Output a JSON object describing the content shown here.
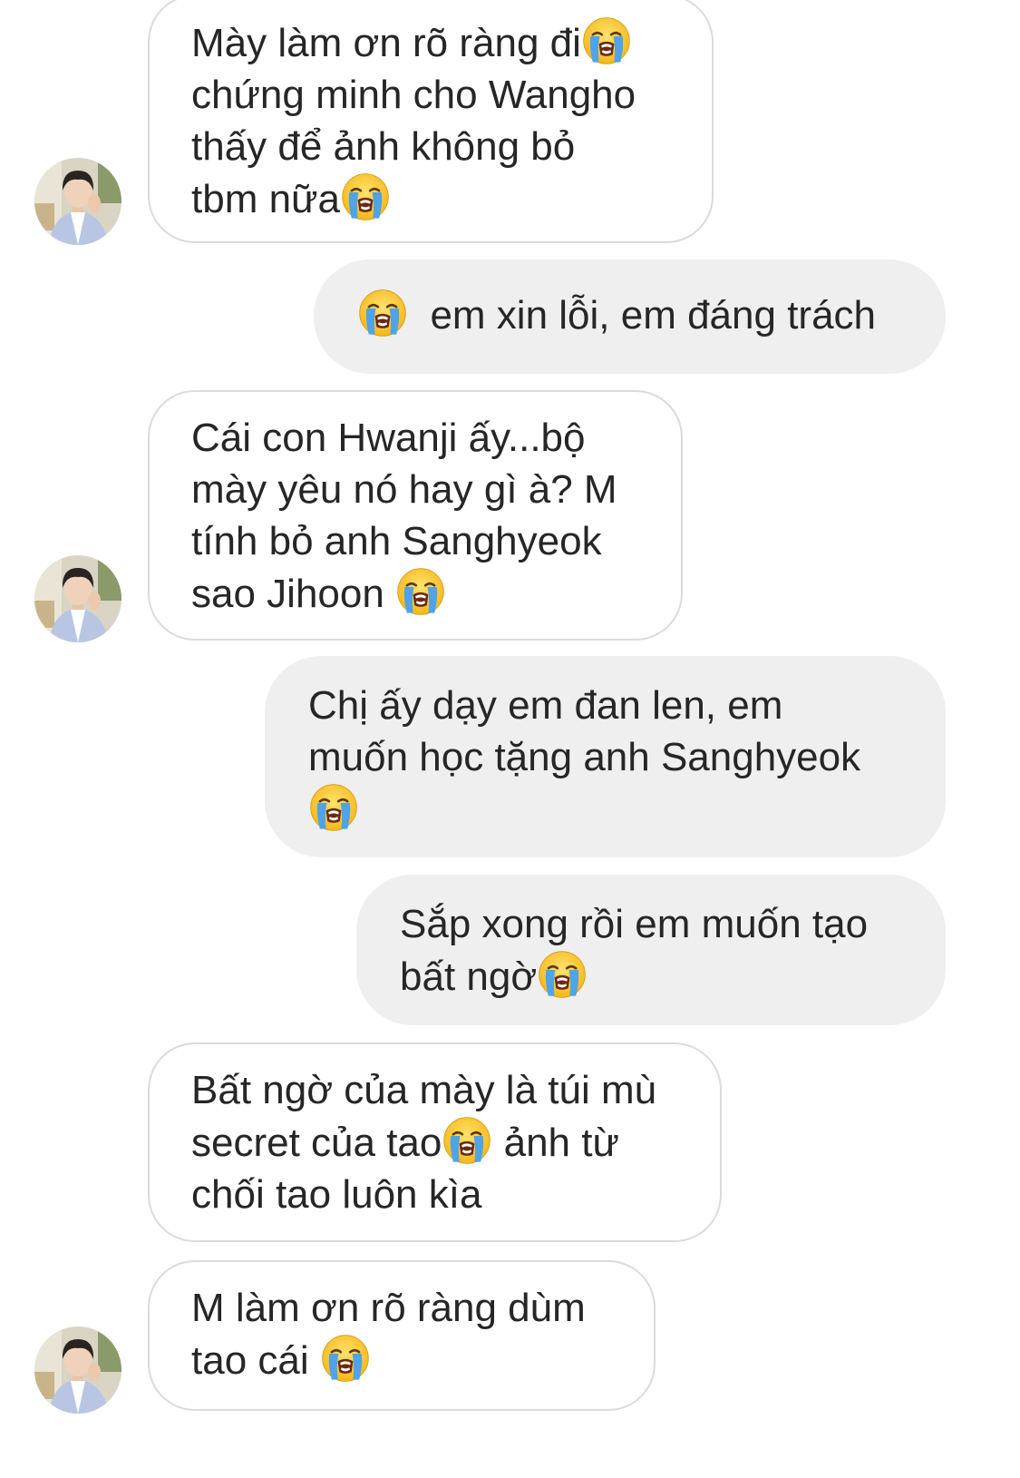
{
  "colors": {
    "incoming_bubble_bg": "#ffffff",
    "incoming_bubble_border": "#dbdbdb",
    "outgoing_bubble_bg": "#efefef",
    "text": "#262626"
  },
  "avatar": {
    "icon": "contact-photo"
  },
  "messages": [
    {
      "sender": "contact",
      "show_avatar": true,
      "parts": [
        "Mày làm ơn rõ ràng đi",
        "[emoji]",
        "\nchứng minh cho Wangho\nthấy để ảnh không bỏ\ntbm nữa",
        "[emoji]"
      ]
    },
    {
      "sender": "me",
      "show_avatar": false,
      "parts": [
        "[emoji]",
        "  em xin lỗi, em đáng trách"
      ]
    },
    {
      "sender": "contact",
      "show_avatar": true,
      "parts": [
        "Cái con Hwanji ấy...bộ\nmày yêu nó hay gì à? M\ntính bỏ anh Sanghyeok\nsao Jihoon ",
        "[emoji]"
      ]
    },
    {
      "sender": "me",
      "show_avatar": false,
      "parts": [
        "Chị ấy dạy em đan len, em\nmuốn học tặng anh Sanghyeok\n",
        "[emoji]"
      ]
    },
    {
      "sender": "me",
      "show_avatar": false,
      "parts": [
        "Sắp xong rồi em muốn tạo\nbất ngờ",
        "[emoji]"
      ]
    },
    {
      "sender": "contact",
      "show_avatar": false,
      "parts": [
        "Bất ngờ của mày là túi mù\nsecret của tao",
        "[emoji]",
        " ảnh từ\nchối tao luôn kìa"
      ]
    },
    {
      "sender": "contact",
      "show_avatar": true,
      "parts": [
        "M làm ơn rõ ràng dùm\ntao cái ",
        "[emoji]"
      ]
    }
  ],
  "emoji": {
    "name": "loudly-crying-face-icon"
  }
}
